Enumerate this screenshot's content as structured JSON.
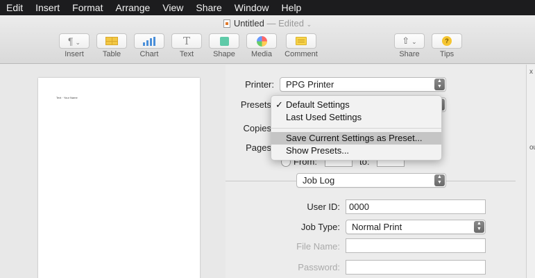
{
  "menubar": [
    "Edit",
    "Insert",
    "Format",
    "Arrange",
    "View",
    "Share",
    "Window",
    "Help"
  ],
  "window": {
    "title": "Untitled",
    "status": "— Edited"
  },
  "toolbar": {
    "insert": "Insert",
    "table": "Table",
    "chart": "Chart",
    "text": "Text",
    "shape": "Shape",
    "media": "Media",
    "comment": "Comment",
    "share": "Share",
    "tips": "Tips",
    "paragraph_glyph": "¶",
    "text_glyph": "T",
    "tips_glyph": "?"
  },
  "preview": {
    "page_text": "Text · Your Name"
  },
  "print": {
    "printer_label": "Printer:",
    "printer_value": "PPG Printer",
    "presets_label": "Presets",
    "copies_label": "Copies",
    "pages_label": "Pages",
    "from_label": "From:",
    "to_label": "to:",
    "section_value": "Job Log",
    "user_id_label": "User ID:",
    "user_id_value": "0000",
    "job_type_label": "Job Type:",
    "job_type_value": "Normal Print",
    "file_name_label": "File Name:",
    "password_label": "Password:"
  },
  "presets_menu": {
    "items": [
      "Default Settings",
      "Last Used Settings",
      "Save Current Settings as Preset...",
      "Show Presets..."
    ],
    "checked": "✓",
    "highlight_color": "#c5c5c5"
  },
  "edge": {
    "x": "x",
    "ou": "ou"
  }
}
